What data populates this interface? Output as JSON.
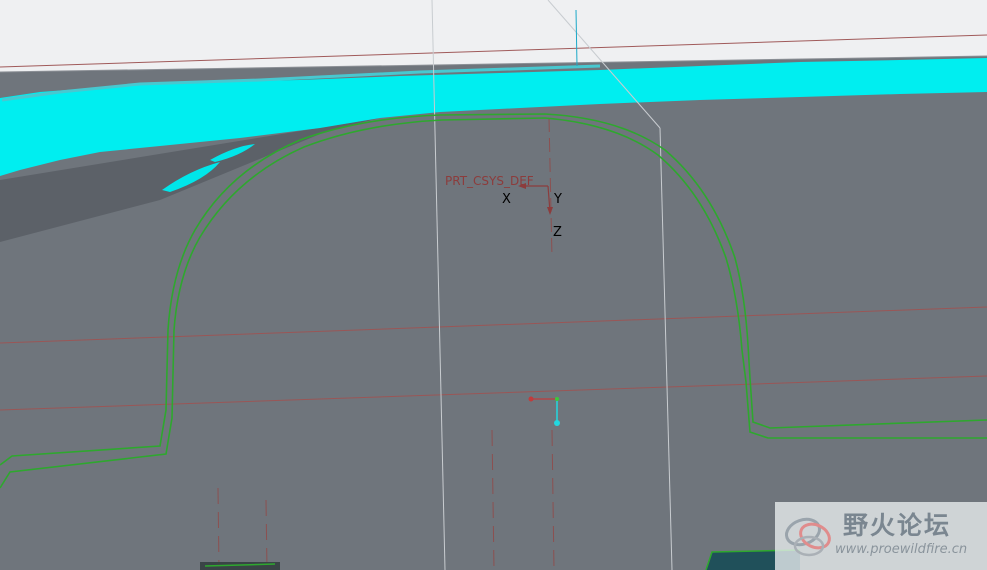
{
  "view": {
    "name": "3d-model-viewport",
    "colors": {
      "background": "#6f757c",
      "top_panel": "#eff0f2",
      "cyan_surface": "#00f0f0",
      "outline": "#2aa02a",
      "datum_plane": "#a05050",
      "edge_line": "#c8ccd0"
    }
  },
  "csys": {
    "name": "PRT_CSYS_DEF",
    "axis_x": "X",
    "axis_y": "Y",
    "axis_z": "Z"
  },
  "watermark": {
    "title": "野火论坛",
    "url": "www.proewildfire.cn",
    "logo_icon": "wildfire-logo-icon"
  }
}
